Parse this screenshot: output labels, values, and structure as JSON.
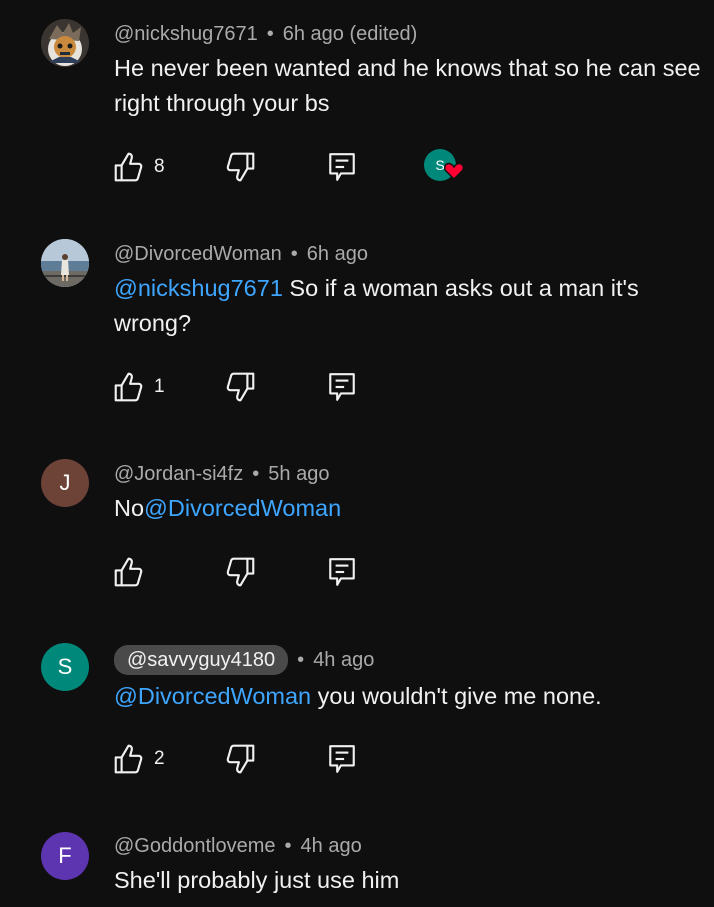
{
  "comments": [
    {
      "author": "@nickshug7671",
      "time": "6h ago (edited)",
      "text": "He never been wanted and he knows that so he can see right through your bs",
      "likes": "8",
      "avatar_initial": "",
      "hearted_by_initial": "S"
    },
    {
      "author": "@DivorcedWoman",
      "time": "6h ago",
      "mention": "@nickshug7671",
      "text": " So if a woman asks out a man it's wrong?",
      "likes": "1",
      "avatar_initial": ""
    },
    {
      "author": "@Jordan-si4fz",
      "time": "5h ago",
      "prefix": "No",
      "mention": "@DivorcedWoman",
      "likes": "",
      "avatar_initial": "J"
    },
    {
      "author": "@savvyguy4180",
      "time": "4h ago",
      "mention": "@DivorcedWoman",
      "text": " you wouldn't give me none.",
      "likes": "2",
      "avatar_initial": "S"
    },
    {
      "author": "@Goddontloveme",
      "time": "4h ago",
      "text": "She'll probably just use him",
      "avatar_initial": "F"
    }
  ],
  "separator": "•",
  "colors": {
    "background": "#0f0f0f",
    "mention": "#3ea6ff",
    "avatar_j": "#6d4338",
    "avatar_s": "#00897b",
    "avatar_f": "#5e35b1",
    "heart": "#ff0033"
  },
  "icons": [
    "like-icon",
    "dislike-icon",
    "reply-icon",
    "heart-icon"
  ]
}
